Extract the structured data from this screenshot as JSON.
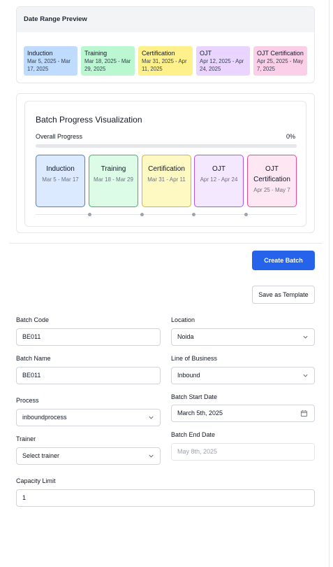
{
  "date_range_preview": {
    "title": "Date Range Preview",
    "chips": [
      {
        "name": "Induction",
        "dates": "Mar 5, 2025 - Mar 17, 2025",
        "color": "#bfdbfe"
      },
      {
        "name": "Training",
        "dates": "Mar 18, 2025 - Mar 29, 2025",
        "color": "#bbf7d0"
      },
      {
        "name": "Certification",
        "dates": "Mar 31, 2025 - Apr 11, 2025",
        "color": "#fef08a"
      },
      {
        "name": "OJT",
        "dates": "Apr 12, 2025 - Apr 24, 2025",
        "color": "#e9d5ff"
      },
      {
        "name": "OJT Certification",
        "dates": "Apr 25, 2025 - May 7, 2025",
        "color": "#fbcfe8"
      }
    ]
  },
  "progress": {
    "title": "Batch Progress Visualization",
    "overall_label": "Overall Progress",
    "overall_value": "0%",
    "overall_fraction": 0,
    "stages": [
      {
        "name": "Induction",
        "dates": "Mar 5 - Mar 17",
        "bg": "#dbeafe",
        "border": "#3b82f6"
      },
      {
        "name": "Training",
        "dates": "Mar 18 - Mar 29",
        "bg": "#dcfce7",
        "border": "#22c55e"
      },
      {
        "name": "Certification",
        "dates": "Mar 31 - Apr 11",
        "bg": "#fef9c3",
        "border": "#eab308"
      },
      {
        "name": "OJT",
        "dates": "Apr 12 - Apr 24",
        "bg": "#f3e8ff",
        "border": "#a855f7"
      },
      {
        "name": "OJT Certification",
        "dates": "Apr 25 - May 7",
        "bg": "#fce7f3",
        "border": "#ec4899"
      }
    ]
  },
  "actions": {
    "create": "Create Batch",
    "save_template": "Save as Template"
  },
  "form": {
    "batch_code": {
      "label": "Batch Code",
      "value": "BE011"
    },
    "location": {
      "label": "Location",
      "value": "Noida"
    },
    "batch_name": {
      "label": "Batch Name",
      "value": "BE011"
    },
    "line_of_business": {
      "label": "Line of Business",
      "value": "Inbound"
    },
    "process": {
      "label": "Process",
      "value": "inboundprocess"
    },
    "batch_start_date": {
      "label": "Batch Start Date",
      "value": "March 5th, 2025"
    },
    "trainer": {
      "label": "Trainer",
      "placeholder": "Select trainer"
    },
    "batch_end_date": {
      "label": "Batch End Date",
      "value": "May 8th, 2025"
    },
    "capacity_limit": {
      "label": "Capacity Limit",
      "value": "1"
    }
  },
  "icons": {
    "dropdown": "chevron-down-icon",
    "calendar": "calendar-icon"
  },
  "colors": {
    "primary": "#2563eb"
  }
}
